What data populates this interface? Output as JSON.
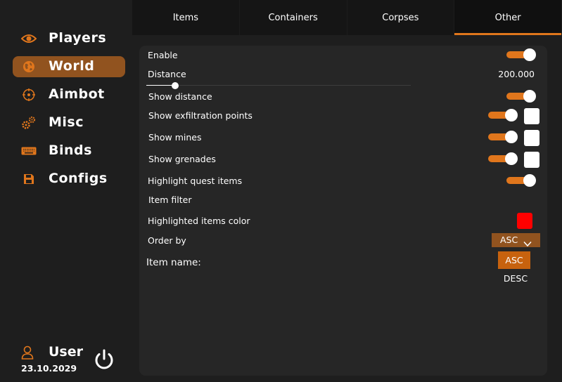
{
  "sidebar": {
    "items": [
      {
        "label": "Players",
        "icon": "eye-icon",
        "active": false
      },
      {
        "label": "World",
        "icon": "globe-icon",
        "active": true
      },
      {
        "label": "Aimbot",
        "icon": "crosshair-icon",
        "active": false
      },
      {
        "label": "Misc",
        "icon": "gears-icon",
        "active": false
      },
      {
        "label": "Binds",
        "icon": "keyboard-icon",
        "active": false
      },
      {
        "label": "Configs",
        "icon": "floppy-disk-icon",
        "active": false
      }
    ],
    "user": {
      "name": "User",
      "date": "23.10.2029",
      "icon": "user-icon"
    },
    "power_icon": "power-icon"
  },
  "tabs": [
    {
      "label": "Items",
      "active": false
    },
    {
      "label": "Containers",
      "active": false
    },
    {
      "label": "Corpses",
      "active": false
    },
    {
      "label": "Other",
      "active": true
    }
  ],
  "settings": {
    "enable": {
      "label": "Enable",
      "checked": true
    },
    "distance": {
      "label": "Distance",
      "value": "200.000",
      "fraction": 0.11
    },
    "show_distance": {
      "label": "Show distance",
      "checked": true
    },
    "show_exfil": {
      "label": "Show exfiltration points",
      "checked": true,
      "color": "#ffffff"
    },
    "show_mines": {
      "label": "Show mines",
      "checked": true,
      "color": "#ffffff"
    },
    "show_grenades": {
      "label": "Show grenades",
      "checked": true,
      "color": "#ffffff"
    },
    "highlight_quest": {
      "label": "Highlight quest items",
      "checked": true
    },
    "item_filter": {
      "label": "Item filter"
    },
    "highlight_color": {
      "label": "Highlighted items color",
      "color": "#ff0000"
    },
    "order_by": {
      "label": "Order by",
      "value": "ASC",
      "options": [
        "ASC",
        "DESC"
      ],
      "selected": "ASC"
    },
    "item_name": {
      "label": "Item name:"
    }
  },
  "colors": {
    "accent": "#e0761c",
    "active_bg": "#91531f",
    "panel": "#262626",
    "background": "#1e1e1e"
  }
}
